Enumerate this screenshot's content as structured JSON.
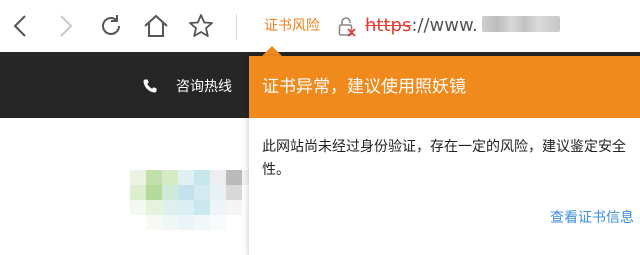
{
  "browser": {
    "toolbar": {
      "back_icon": "back-arrow-icon",
      "forward_icon": "forward-arrow-icon",
      "refresh_icon": "refresh-icon",
      "home_icon": "home-icon",
      "favorite_icon": "star-icon"
    },
    "address_bar": {
      "cert_warning_label": "证书风险",
      "lock_icon": "broken-lock-icon",
      "url_scheme": "https",
      "url_visible": "://www."
    }
  },
  "page": {
    "hotline_label": "咨询热线",
    "phone_icon": "phone-icon"
  },
  "cert_popup": {
    "title": "证书异常，建议使用照妖镜",
    "message": "此网站尚未经过身份验证，存在一定的风险，建议鉴定安全性。",
    "link_label": "查看证书信息"
  },
  "colors": {
    "accent_orange": "#f18a1c",
    "warning_label": "#f0801e",
    "insecure_red": "#e03c31",
    "link_blue": "#3c8fdc",
    "header_dark": "#262626"
  }
}
